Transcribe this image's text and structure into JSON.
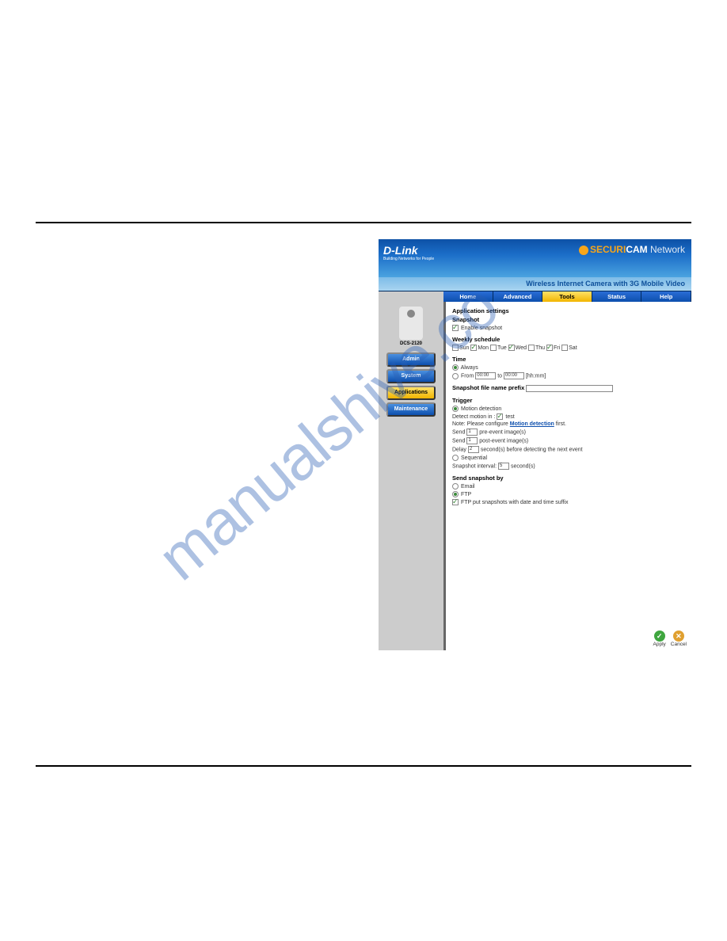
{
  "watermark": "manualshive.co",
  "header": {
    "logo": "D-Link",
    "logo_sub": "Building Networks for People",
    "brand_prefix": "SECURI",
    "brand_accent": "CAM",
    "brand_suffix": "Network",
    "subtitle": "Wireless Internet Camera with 3G Mobile Video"
  },
  "nav": {
    "tabs": [
      "Home",
      "Advanced",
      "Tools",
      "Status",
      "Help"
    ],
    "active": "Tools"
  },
  "sidebar": {
    "model": "DCS-2120",
    "buttons": [
      {
        "label": "Admin",
        "style": "blue"
      },
      {
        "label": "System",
        "style": "blue"
      },
      {
        "label": "Applications",
        "style": "yellow"
      },
      {
        "label": "Maintenance",
        "style": "blue"
      }
    ]
  },
  "content": {
    "title": "Application settings",
    "snapshot": {
      "heading": "Snapshot",
      "enable_label": "Enable snapshot",
      "enable_checked": true
    },
    "weekly": {
      "heading": "Weekly schedule",
      "days": [
        {
          "label": "Sun",
          "checked": false
        },
        {
          "label": "Mon",
          "checked": true
        },
        {
          "label": "Tue",
          "checked": false
        },
        {
          "label": "Wed",
          "checked": true
        },
        {
          "label": "Thu",
          "checked": false
        },
        {
          "label": "Fri",
          "checked": true
        },
        {
          "label": "Sat",
          "checked": false
        }
      ]
    },
    "time": {
      "heading": "Time",
      "always_label": "Always",
      "from_label": "From",
      "to_label": "to",
      "from_val": "00:00",
      "to_val": "00:00",
      "hint": "[hh:mm]",
      "selected": "always"
    },
    "prefix": {
      "label": "Snapshot file name prefix",
      "value": ""
    },
    "trigger": {
      "heading": "Trigger",
      "motion_label": "Motion detection",
      "detect_label": "Detect motion in :",
      "test_label": "test",
      "note_prefix": "Note: Please configure",
      "note_link": "Motion detection",
      "note_suffix": "first.",
      "send_pre_label1": "Send",
      "send_pre_val": "1",
      "send_pre_label2": "pre-event image(s)",
      "send_post_label1": "Send",
      "send_post_val": "1",
      "send_post_label2": "post-event image(s)",
      "delay_label1": "Delay",
      "delay_val": "2",
      "delay_label2": "second(s) before detecting the next event",
      "seq_label": "Sequential",
      "seq_interval_label1": "Snapshot interval:",
      "seq_interval_val": "5",
      "seq_interval_label2": "second(s)",
      "selected": "motion"
    },
    "send": {
      "heading": "Send snapshot by",
      "email_label": "Email",
      "ftp_label": "FTP",
      "ftp_suffix_label": "FTP put snapshots with date and time suffix",
      "selected": "ftp",
      "ftp_suffix_checked": true
    },
    "actions": {
      "apply": "Apply",
      "cancel": "Cancel"
    }
  }
}
